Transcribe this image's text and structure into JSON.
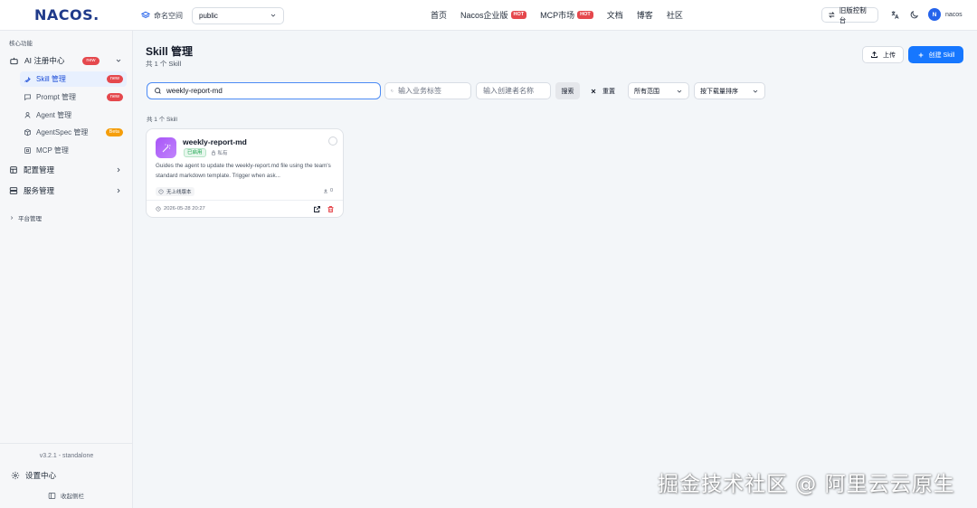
{
  "header": {
    "logo_text": "NACOS.",
    "namespace_label": "命名空间",
    "namespace_value": "public",
    "nav": [
      {
        "label": "首页",
        "badge": ""
      },
      {
        "label": "Nacos企业版",
        "badge": "HOT"
      },
      {
        "label": "MCP市场",
        "badge": "HOT"
      },
      {
        "label": "文档",
        "badge": ""
      },
      {
        "label": "博客",
        "badge": ""
      },
      {
        "label": "社区",
        "badge": ""
      }
    ],
    "old_console_label": "旧版控制台",
    "user_initial": "N",
    "user_name": "nacos"
  },
  "sidebar": {
    "group_label": "核心功能",
    "ai_center": {
      "label": "AI 注册中心",
      "badge": "new"
    },
    "sub_items": [
      {
        "label": "Skill 管理",
        "badge": "new"
      },
      {
        "label": "Prompt 管理",
        "badge": "new"
      },
      {
        "label": "Agent 管理",
        "badge": ""
      },
      {
        "label": "AgentSpec 管理",
        "badge": "Beta"
      },
      {
        "label": "MCP 管理",
        "badge": ""
      }
    ],
    "config_label": "配置管理",
    "service_label": "服务管理",
    "platform_label": "平台管理",
    "version": "v3.2.1 - standalone",
    "settings_label": "设置中心",
    "collapse_label": "收起侧栏"
  },
  "main": {
    "title": "Skill 管理",
    "subtitle": "共 1 个 Skill",
    "upload_label": "上传",
    "create_label": "创建 Skill",
    "search_value": "weekly-report-md",
    "tag_placeholder": "输入业务标签",
    "creator_placeholder": "输入创建者名称",
    "search_button": "搜索",
    "reset_button": "重置",
    "scope_value": "所有范围",
    "sort_value": "按下载量排序",
    "result_count": "共 1 个 Skill"
  },
  "card": {
    "title": "weekly-report-md",
    "status": "已启用",
    "visibility": "私有",
    "description": "Guides the agent to update the weekly-report.md file using the team's standard markdown template. Trigger when ask...",
    "tag": "无上线版本",
    "downloads": "0",
    "date": "2026-05-28 20:27"
  },
  "watermark": "掘金技术社区 @ 阿里云云原生",
  "colors": {
    "primary": "#1677ff",
    "hot_badge": "#e5484d",
    "beta_badge": "#f59e0b",
    "enabled_green": "#16a34a",
    "active_menu_bg": "#e8f0fe"
  }
}
